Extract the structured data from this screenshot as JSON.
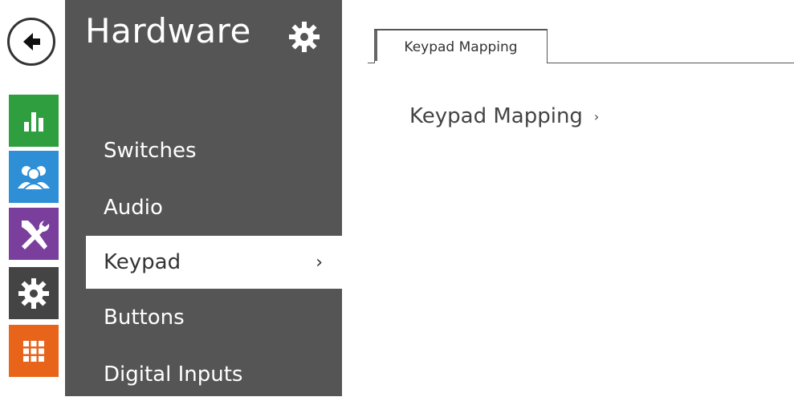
{
  "rail": {
    "back_icon": "arrow-left-icon",
    "tiles": [
      {
        "name": "status",
        "icon": "bar-chart-icon",
        "color": "#2e9e3e"
      },
      {
        "name": "directory",
        "icon": "users-icon",
        "color": "#2f8fd6"
      },
      {
        "name": "hardware",
        "icon": "tools-icon",
        "color": "#7a3e9d"
      },
      {
        "name": "system",
        "icon": "gear-icon",
        "color": "#444444"
      },
      {
        "name": "services",
        "icon": "grid-icon",
        "color": "#e8641b"
      }
    ]
  },
  "nav": {
    "title": "Hardware",
    "gear_icon": "gear-icon",
    "items": [
      {
        "label": "Switches"
      },
      {
        "label": "Audio"
      },
      {
        "label": "Keypad",
        "active": true,
        "chevron": "›"
      },
      {
        "label": "Buttons"
      },
      {
        "label": "Digital Inputs"
      }
    ],
    "bg_color": "#555555"
  },
  "main": {
    "tabs": [
      {
        "label": "Keypad Mapping"
      }
    ],
    "section": {
      "label": "Keypad Mapping",
      "chevron": "›"
    }
  }
}
